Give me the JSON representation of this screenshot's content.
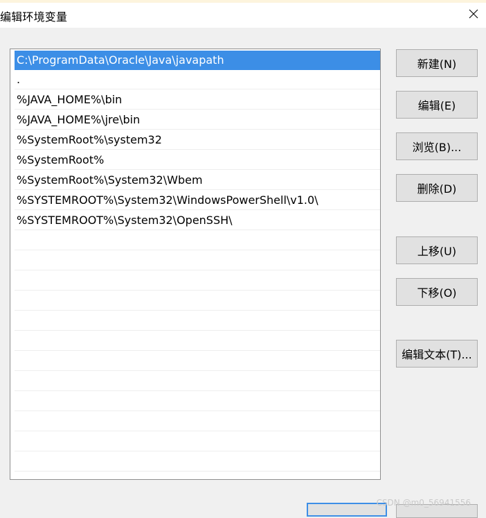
{
  "dialog": {
    "title": "编辑环境变量"
  },
  "list": {
    "items": [
      "C:\\ProgramData\\Oracle\\Java\\javapath",
      ".",
      "%JAVA_HOME%\\bin",
      "%JAVA_HOME%\\jre\\bin",
      "%SystemRoot%\\system32",
      "%SystemRoot%",
      "%SystemRoot%\\System32\\Wbem",
      "%SYSTEMROOT%\\System32\\WindowsPowerShell\\v1.0\\",
      "%SYSTEMROOT%\\System32\\OpenSSH\\"
    ],
    "selected_index": 0
  },
  "buttons": {
    "new": "新建(N)",
    "edit": "编辑(E)",
    "browse": "浏览(B)...",
    "delete": "删除(D)",
    "move_up": "上移(U)",
    "move_down": "下移(O)",
    "edit_text": "编辑文本(T)..."
  },
  "watermark": "CSDN @m0_56941556",
  "icons": {
    "close": "close-icon"
  },
  "colors": {
    "selection": "#3c8ee6",
    "window_bg": "#f0f0f0",
    "button_bg": "#e1e1e1"
  }
}
